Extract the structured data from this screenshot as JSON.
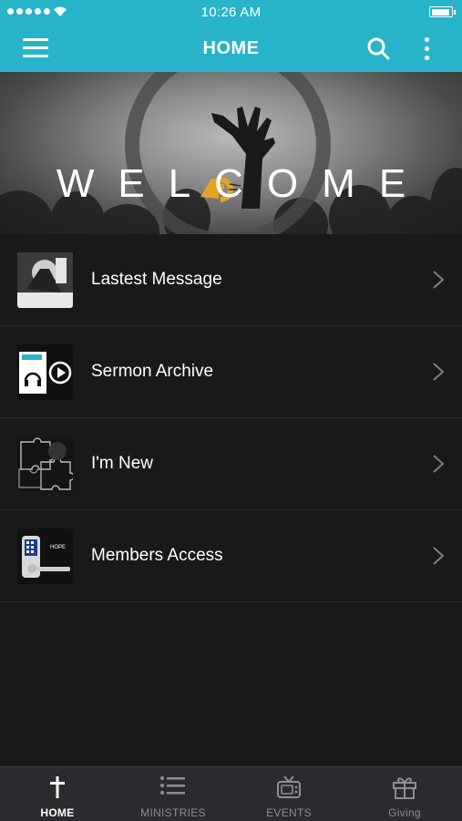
{
  "status_bar": {
    "time": "10:26 AM"
  },
  "nav": {
    "title": "HOME"
  },
  "banner": {
    "headline": "WELCOME"
  },
  "list": [
    {
      "label": "Lastest Message"
    },
    {
      "label": "Sermon Archive"
    },
    {
      "label": "I'm New"
    },
    {
      "label": "Members Access"
    }
  ],
  "tabs": [
    {
      "label": "HOME",
      "icon": "cross-icon",
      "active": true
    },
    {
      "label": "MINISTRIES",
      "icon": "list-icon",
      "active": false
    },
    {
      "label": "EVENTS",
      "icon": "tv-icon",
      "active": false
    },
    {
      "label": "Giving",
      "icon": "gift-icon",
      "active": false
    }
  ],
  "colors": {
    "accent": "#27b4c9",
    "background": "#18191b",
    "tabbar": "#2a2b2e",
    "logo_gold": "#e2a526"
  }
}
